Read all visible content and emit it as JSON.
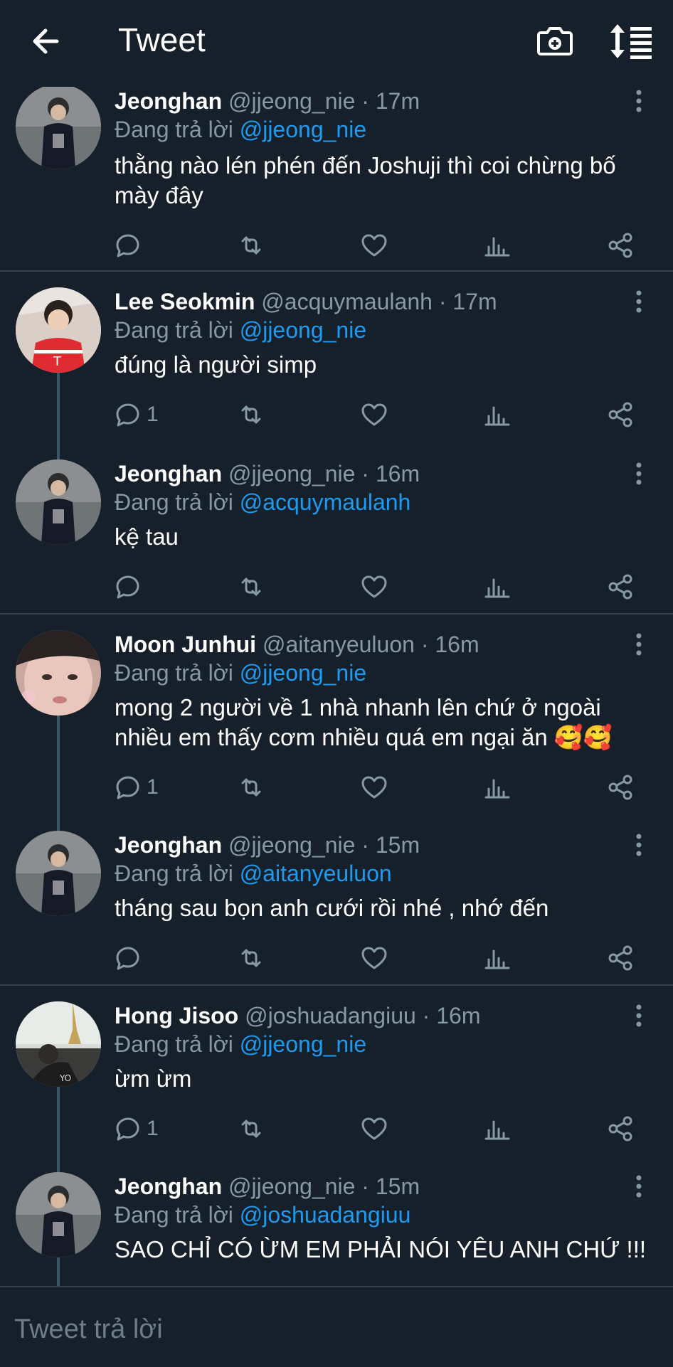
{
  "header": {
    "title": "Tweet",
    "back_icon": "back-arrow-icon",
    "camera_icon": "camera-plus-icon",
    "sort_icon": "sort-icon"
  },
  "reply_prefix": "Đang trả lời",
  "tweets": [
    {
      "name": "Jeonghan",
      "handle": "@jjeong_nie",
      "time": "· 17m",
      "reply_to": "@jjeong_nie",
      "text": "thằng nào lén phén đến Joshuji thì coi chừng bố mày đây",
      "reply_count": ""
    },
    {
      "name": "Lee Seokmin",
      "handle": "@acquymaulanh",
      "time": "· 17m",
      "reply_to": "@jjeong_nie",
      "text": "đúng là người simp",
      "reply_count": "1"
    },
    {
      "name": "Jeonghan",
      "handle": "@jjeong_nie",
      "time": "· 16m",
      "reply_to": "@acquymaulanh",
      "text": "kệ tau",
      "reply_count": ""
    },
    {
      "name": "Moon Junhui",
      "handle": "@aitanyeuluon",
      "time": "· 16m",
      "reply_to": "@jjeong_nie",
      "text": "mong 2 người về 1 nhà nhanh lên chứ ở ngoài nhiều em thấy cơm nhiều quá em ngại ăn 🥰🥰",
      "reply_count": "1"
    },
    {
      "name": "Jeonghan",
      "handle": "@jjeong_nie",
      "time": "· 15m",
      "reply_to": "@aitanyeuluon",
      "text": "tháng sau bọn anh cưới rồi nhé , nhớ đến",
      "reply_count": ""
    },
    {
      "name": "Hong Jisoo",
      "handle": "@joshuadangiuu",
      "time": "· 16m",
      "reply_to": "@jjeong_nie",
      "text": "ừm ừm",
      "reply_count": "1"
    },
    {
      "name": "Jeonghan",
      "handle": "@jjeong_nie",
      "time": "· 15m",
      "reply_to": "@joshuadangiuu",
      "text": "SAO CHỈ CÓ ỪM EM PHẢI NÓI YÊU ANH CHỨ !!!",
      "reply_count": ""
    }
  ],
  "reply_bar": {
    "placeholder": "Tweet trả lời"
  }
}
